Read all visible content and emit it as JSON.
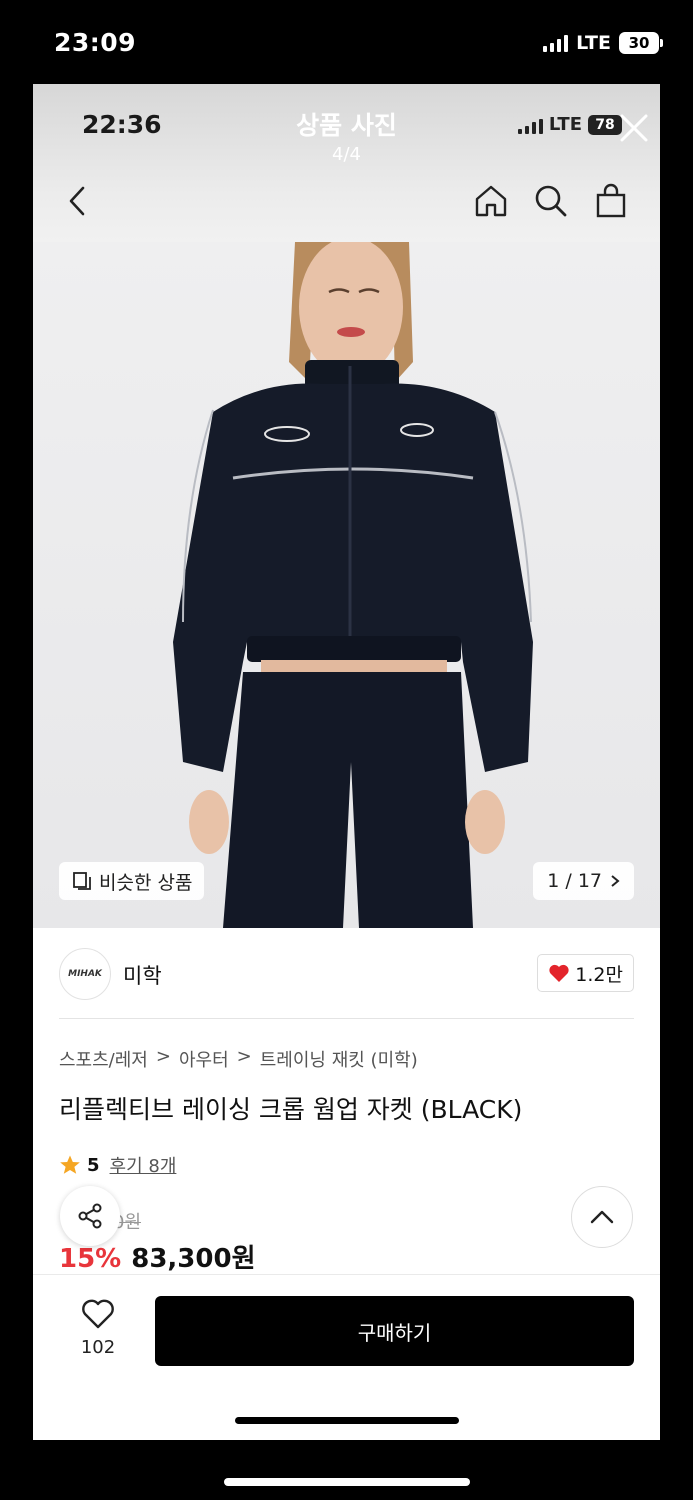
{
  "device": {
    "time": "23:09",
    "network": "LTE",
    "battery": "30"
  },
  "viewer": {
    "time": "22:36",
    "network": "LTE",
    "battery": "78",
    "title": "상품 사진",
    "counter": "4/4"
  },
  "nav": {
    "icons": [
      "back-icon",
      "home-icon",
      "search-icon",
      "bag-icon"
    ]
  },
  "image": {
    "similar_label": "비슷한 상품",
    "page_indicator": "1 / 17"
  },
  "brand": {
    "logo_text": "MIHAK",
    "name": "미학",
    "likes": "1.2만"
  },
  "product": {
    "breadcrumb": [
      "스포츠/레저",
      "아우터",
      "트레이닝 재킷 (미학)"
    ],
    "title": "리플렉티브 레이싱 크롭 웜업 자켓 (BLACK)",
    "rating": "5",
    "reviews": "후기 8개",
    "original_price": "0원",
    "discount": "15%",
    "price": "83,300원"
  },
  "bottom": {
    "wish_count": "102",
    "buy_label": "구매하기"
  },
  "colors": {
    "discount": "#e8353b",
    "buy_button": "#000000",
    "heart": "#e3242b",
    "star": "#f5a623"
  }
}
